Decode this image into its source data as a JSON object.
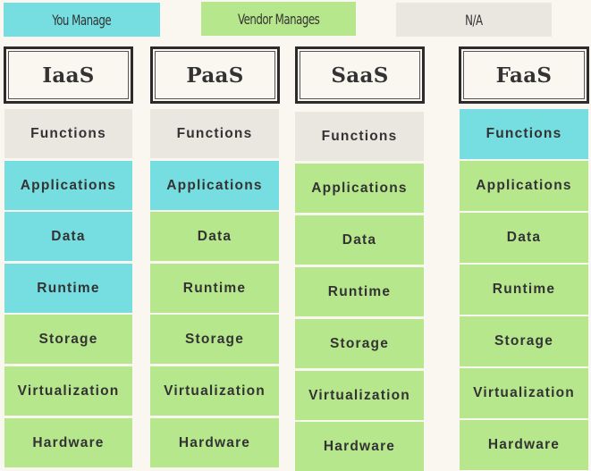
{
  "legend": [
    {
      "key": "you",
      "label": "You Manage",
      "color": "#76dee0"
    },
    {
      "key": "vendor",
      "label": "Vendor Manages",
      "color": "#b7e78c"
    },
    {
      "key": "na",
      "label": "N/A",
      "color": "#eae7e0"
    }
  ],
  "layers": [
    "Functions",
    "Applications",
    "Data",
    "Runtime",
    "Storage",
    "Virtualization",
    "Hardware"
  ],
  "models": [
    {
      "name": "IaaS",
      "cells": [
        "na",
        "you",
        "you",
        "you",
        "vendor",
        "vendor",
        "vendor"
      ]
    },
    {
      "name": "PaaS",
      "cells": [
        "na",
        "you",
        "vendor",
        "vendor",
        "vendor",
        "vendor",
        "vendor"
      ]
    },
    {
      "name": "SaaS",
      "cells": [
        "na",
        "vendor",
        "vendor",
        "vendor",
        "vendor",
        "vendor",
        "vendor"
      ]
    },
    {
      "name": "FaaS",
      "cells": [
        "you",
        "vendor",
        "vendor",
        "vendor",
        "vendor",
        "vendor",
        "vendor"
      ]
    }
  ]
}
